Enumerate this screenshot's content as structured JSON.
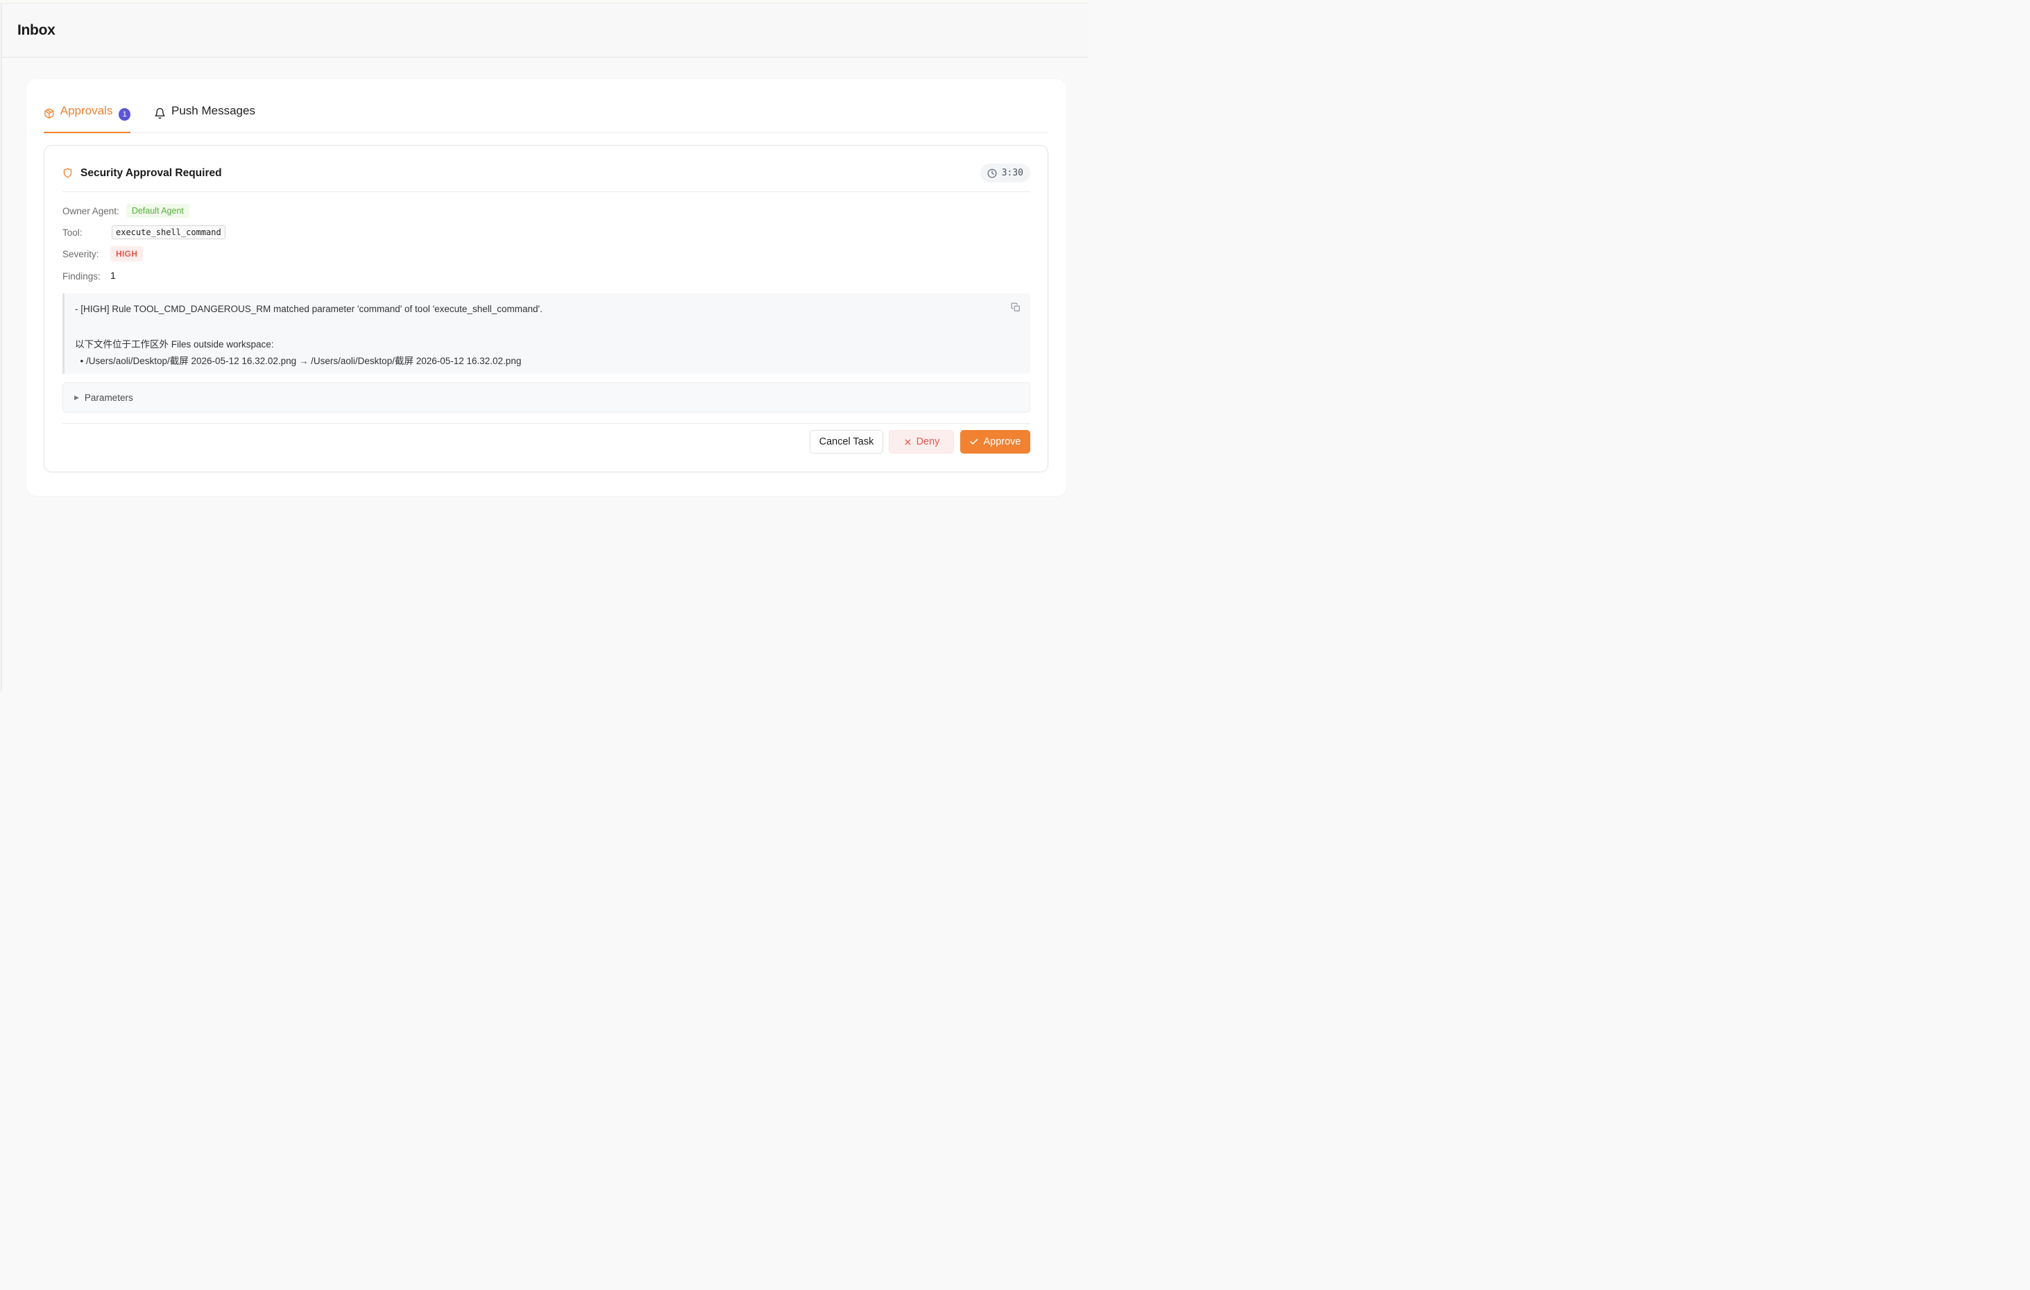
{
  "header": {
    "title": "Inbox"
  },
  "tabs": [
    {
      "label": "Approvals",
      "badge": "1",
      "icon": "package-icon",
      "active": true
    },
    {
      "label": "Push Messages",
      "icon": "bell-icon",
      "active": false
    }
  ],
  "approval": {
    "title": "Security Approval Required",
    "timer": "3:30",
    "owner_label": "Owner Agent:",
    "owner_value": "Default Agent",
    "tool_label": "Tool:",
    "tool_value": "execute_shell_command",
    "severity_label": "Severity:",
    "severity_value": "HIGH",
    "findings_label": "Findings:",
    "findings_value": "1",
    "finding_lines": [
      "- [HIGH] Rule TOOL_CMD_DANGEROUS_RM matched parameter 'command' of tool 'execute_shell_command'.",
      "以下文件位于工作区外 Files outside workspace:",
      "  • /Users/aoli/Desktop/截屏 2026-05-12 16.32.02.png → /Users/aoli/Desktop/截屏 2026-05-12 16.32.02.png"
    ],
    "parameters_label": "Parameters"
  },
  "actions": {
    "cancel": "Cancel Task",
    "deny": "Deny",
    "approve": "Approve"
  },
  "colors": {
    "accent": "#f08232",
    "badge": "#5b55d8",
    "success": "#56b13f",
    "danger": "#e2574c"
  }
}
